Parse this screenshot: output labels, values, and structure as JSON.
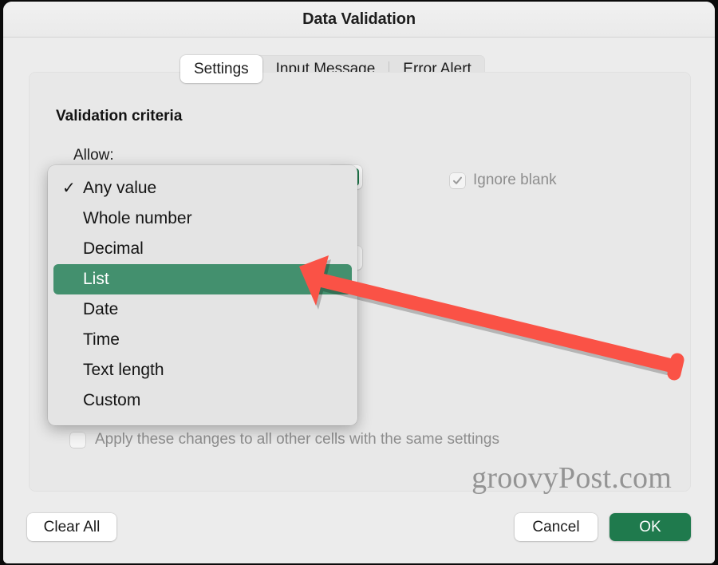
{
  "window": {
    "title": "Data Validation"
  },
  "tabs": [
    {
      "label": "Settings",
      "active": true
    },
    {
      "label": "Input Message",
      "active": false
    },
    {
      "label": "Error Alert",
      "active": false
    }
  ],
  "panel": {
    "criteria_heading": "Validation criteria",
    "allow_label": "Allow:",
    "ignore_blank_label": "Ignore blank",
    "ignore_blank_checked": true,
    "ignore_blank_enabled": false,
    "apply_all_label": "Apply these changes to all other cells with the same settings",
    "apply_all_checked": false,
    "apply_all_enabled": false
  },
  "dropdown": {
    "open": true,
    "checked_value": "Any value",
    "highlighted_value": "List",
    "items": [
      {
        "label": "Any value",
        "checked": true,
        "highlighted": false
      },
      {
        "label": "Whole number",
        "checked": false,
        "highlighted": false
      },
      {
        "label": "Decimal",
        "checked": false,
        "highlighted": false
      },
      {
        "label": "List",
        "checked": false,
        "highlighted": true
      },
      {
        "label": "Date",
        "checked": false,
        "highlighted": false
      },
      {
        "label": "Time",
        "checked": false,
        "highlighted": false
      },
      {
        "label": "Text length",
        "checked": false,
        "highlighted": false
      },
      {
        "label": "Custom",
        "checked": false,
        "highlighted": false
      }
    ]
  },
  "footer": {
    "clear_all_label": "Clear All",
    "cancel_label": "Cancel",
    "ok_label": "OK"
  },
  "watermark": {
    "text": "groovyPost.com"
  },
  "annotation": {
    "arrow_color": "#fa5246",
    "points_at": "List"
  },
  "colors": {
    "accent_green": "#1f7a4d",
    "highlight_green": "#43906e",
    "window_bg": "#ececec",
    "panel_bg": "#e8e8e8",
    "menu_bg": "#e4e4e4",
    "arrow_red": "#fa5246",
    "disabled_text": "#8e8e8e"
  },
  "icons": {
    "checkmark": "check-icon",
    "chevron_down": "chevron-down-icon",
    "arrow": "arrow-pointer-icon"
  }
}
